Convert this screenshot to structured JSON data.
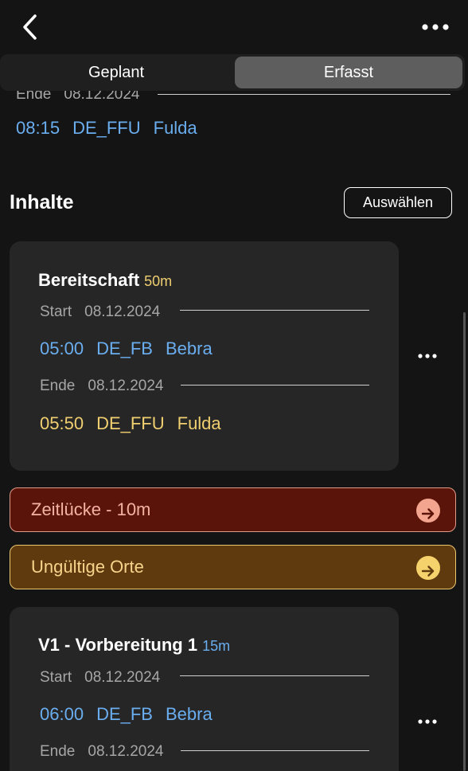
{
  "segments": {
    "planned": "Geplant",
    "recorded": "Erfasst",
    "selected": "Erfasst"
  },
  "partial": {
    "end_label": "Ende",
    "end_date": "08.12.2024",
    "time": "08:15",
    "code": "DE_FFU",
    "city": "Fulda"
  },
  "section": {
    "title": "Inhalte",
    "select_label": "Auswählen"
  },
  "cards": [
    {
      "title": "Bereitschaft",
      "duration": "50m",
      "start_label": "Start",
      "start_date": "08.12.2024",
      "start_time": "05:00",
      "start_code": "DE_FB",
      "start_city": "Bebra",
      "end_label": "Ende",
      "end_date": "08.12.2024",
      "end_time": "05:50",
      "end_code": "DE_FFU",
      "end_city": "Fulda"
    },
    {
      "title": "V1 - Vorbereitung 1",
      "duration": "15m",
      "start_label": "Start",
      "start_date": "08.12.2024",
      "start_time": "06:00",
      "start_code": "DE_FB",
      "start_city": "Bebra",
      "end_label": "Ende",
      "end_date": "08.12.2024"
    }
  ],
  "banners": {
    "gap": "Zeitlücke - 10m",
    "invalid": "Ungültige Orte"
  },
  "icons": {
    "back": "chevron-left-icon",
    "more": "ellipsis-icon",
    "arrow": "arrow-right-circle-icon"
  },
  "colors": {
    "background": "#141414",
    "card": "#262626",
    "blue": "#6aaef0",
    "yellow": "#f0cf70",
    "gap_bg": "#5b1409",
    "invalid_bg": "#5e3a0e"
  }
}
